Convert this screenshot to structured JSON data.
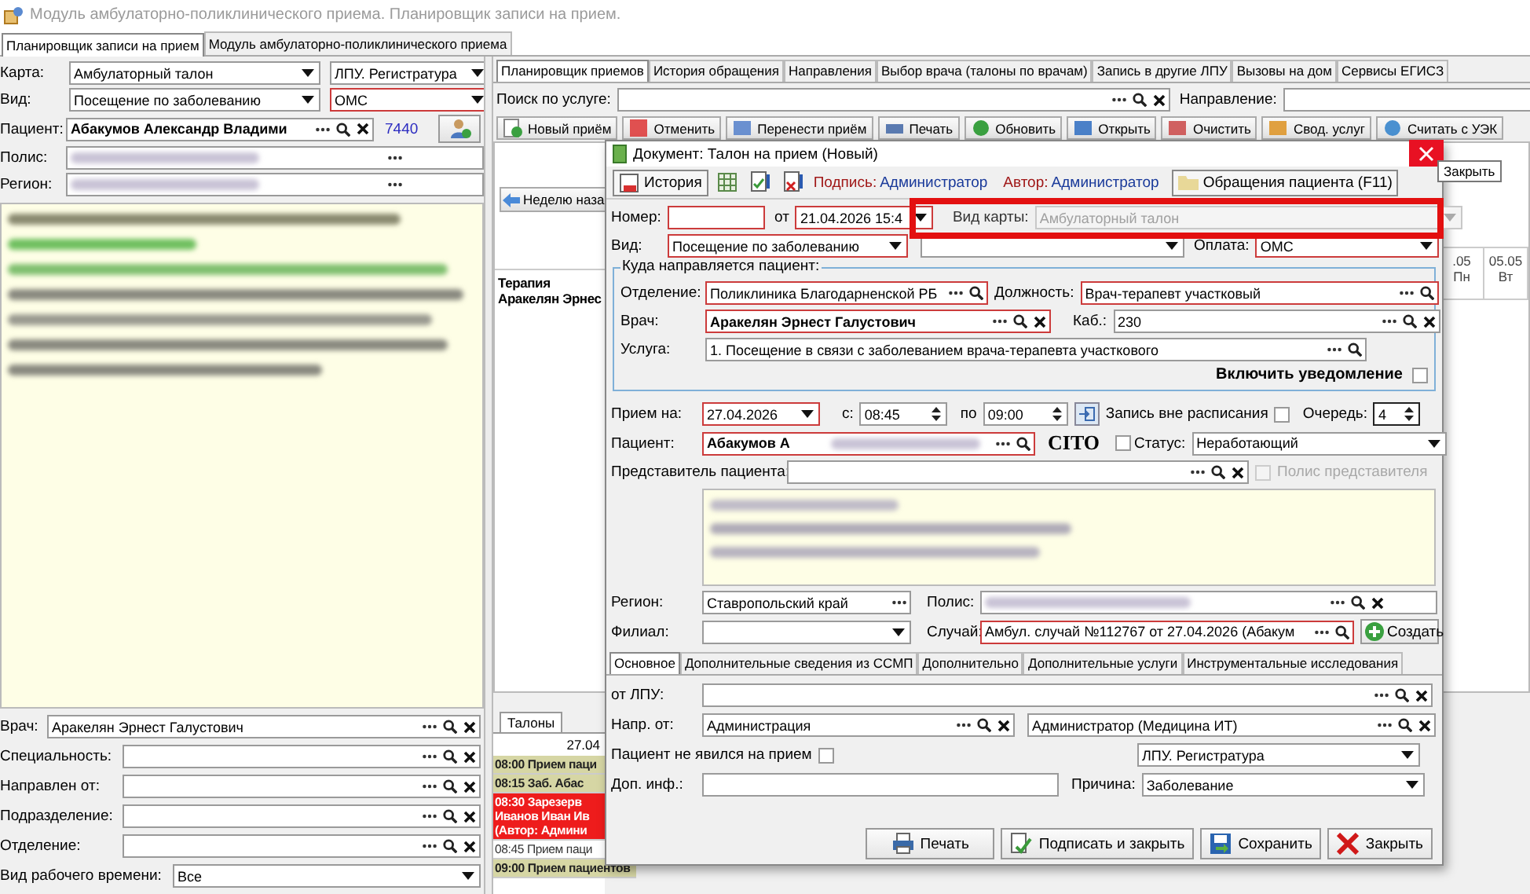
{
  "window": {
    "title": "Модуль амбулаторно-поликлинического приема. Планировщик записи на прием."
  },
  "module_tabs": [
    {
      "label": "Планировщик записи на прием",
      "selected": true
    },
    {
      "label": "Модуль амбулаторно-поликлинического приема",
      "selected": false
    }
  ],
  "left_panel": {
    "rows": [
      {
        "label": "Карта:",
        "fields": [
          {
            "kind": "combo",
            "value": "Амбулаторный талон",
            "invalid": false
          },
          {
            "kind": "combo",
            "value": "ЛПУ. Регистратура",
            "invalid": false
          }
        ]
      },
      {
        "label": "Вид:",
        "fields": [
          {
            "kind": "combo",
            "value": "Посещение по заболеванию",
            "invalid": false
          },
          {
            "kind": "combo",
            "value": "ОМС",
            "invalid": true
          }
        ]
      },
      {
        "label": "Пациент:",
        "fields": [
          {
            "kind": "lookup",
            "value": "Абакумов Александр Владими",
            "invalid": false,
            "searchable": true,
            "clearable": true
          }
        ],
        "link": "7440"
      },
      {
        "label": "Полис:",
        "fields": [
          {
            "kind": "lookup",
            "invalid": false,
            "redacted": true,
            "searchable": false,
            "clearable": false
          }
        ]
      },
      {
        "label": "Регион:",
        "fields": [
          {
            "kind": "lookup",
            "invalid": false,
            "redacted": true,
            "searchable": false,
            "clearable": false
          }
        ]
      }
    ],
    "lower_rows": [
      {
        "label": "Врач:",
        "field": {
          "kind": "lookup",
          "value": "Аракелян Эрнест Галустович",
          "invalid": false,
          "searchable": true,
          "clearable": true
        }
      },
      {
        "label": "Специальность:",
        "field": {
          "kind": "lookup",
          "invalid": false,
          "searchable": true,
          "clearable": true
        }
      },
      {
        "label": "Направлен от:",
        "field": {
          "kind": "lookup",
          "invalid": false,
          "searchable": true,
          "clearable": true
        }
      },
      {
        "label": "Подразделение:",
        "field": {
          "kind": "lookup",
          "invalid": false,
          "searchable": true,
          "clearable": true
        }
      },
      {
        "label": "Отделение:",
        "field": {
          "kind": "lookup",
          "invalid": false,
          "searchable": true,
          "clearable": true
        }
      },
      {
        "label": "Вид рабочего времени:",
        "field": {
          "kind": "combo",
          "value": "Все",
          "invalid": false
        }
      }
    ]
  },
  "right_panel": {
    "tabs": [
      {
        "label": "Планировщик приемов",
        "selected": true
      },
      {
        "label": "История обращения",
        "selected": false
      },
      {
        "label": "Направления",
        "selected": false
      },
      {
        "label": "Выбор врача (талоны по врачам)",
        "selected": false
      },
      {
        "label": "Запись в другие ЛПУ",
        "selected": false
      },
      {
        "label": "Вызовы на дом",
        "selected": false
      },
      {
        "label": "Сервисы ЕГИСЗ",
        "selected": false
      }
    ],
    "search_label": "Поиск по услуге:",
    "direction_label": "Направление:",
    "toolbar": [
      {
        "label": "Новый приём",
        "kind": "new"
      },
      {
        "label": "Отменить",
        "kind": "cancel"
      },
      {
        "label": "Перенести приём",
        "kind": "move"
      },
      {
        "label": "Печать",
        "kind": "print"
      },
      {
        "label": "Обновить",
        "kind": "refresh"
      },
      {
        "label": "Открыть",
        "kind": "open"
      },
      {
        "label": "Очистить",
        "kind": "clear"
      },
      {
        "label": "Свод. услуг",
        "kind": "summary"
      },
      {
        "label": "Считать с УЭК",
        "kind": "card"
      }
    ],
    "week_back": "Неделю наза",
    "days": [
      {
        "date": ".05",
        "weekday": "Пн"
      },
      {
        "date": "05.05",
        "weekday": "Вт"
      }
    ],
    "schedule_column": [
      "Терапия",
      "Аракелян Эрнес"
    ],
    "talons_tab": "Талоны",
    "talons_date": "27.04",
    "talons": [
      {
        "lines": [
          "08:00 Прием паци"
        ],
        "kind": "open"
      },
      {
        "lines": [
          "08:15 Заб. Абас"
        ],
        "kind": "booked"
      },
      {
        "lines": [
          "08:30 Зарезерв",
          "Иванов Иван Ив",
          "(Автор: Админи"
        ],
        "kind": "reserved"
      },
      {
        "lines": [
          "08:45 Прием паци"
        ],
        "kind": "plain"
      },
      {
        "lines": [
          "09:00 Прием пациентов"
        ],
        "kind": "open"
      }
    ]
  },
  "dialog": {
    "title": "Документ: Талон на прием (Новый)",
    "close_tooltip": "Закрыть",
    "history": "История",
    "signature_label": "Подпись:",
    "signature": "Администратор",
    "author_label": "Автор:",
    "author": "Администратор",
    "visits": "Обращения пациента (F11)",
    "number": {
      "label": "Номер:",
      "kind": "text",
      "invalid": true
    },
    "date": {
      "label": "от",
      "kind": "combo",
      "value": "21.04.2026 15:4",
      "invalid": true
    },
    "card_type": {
      "label": "Вид карты:",
      "kind": "combo",
      "value": "Амбулаторный талон",
      "invalid": false,
      "disabled": true,
      "highlighted": true
    },
    "visit_type": {
      "label": "Вид:",
      "kind": "combo",
      "value": "Посещение по заболеванию",
      "invalid": true
    },
    "visit_subtype": {
      "kind": "combo",
      "invalid": false
    },
    "payment": {
      "label": "Оплата:",
      "kind": "combo",
      "value": "ОМС",
      "invalid": true
    },
    "destination_title": "Куда направляется пациент:",
    "department": {
      "label": "Отделение:",
      "kind": "lookup",
      "value": "Поликлиника Благодарненской РБ",
      "invalid": true,
      "searchable": true,
      "clearable": false
    },
    "position": {
      "label": "Должность:",
      "kind": "lookup",
      "value": "Врач-терапевт участковый",
      "invalid": true,
      "searchable": true,
      "clearable": false
    },
    "doctor": {
      "label": "Врач:",
      "kind": "lookup",
      "value": "Аракелян Эрнест Галустович",
      "invalid": true,
      "searchable": true,
      "clearable": true
    },
    "room": {
      "label": "Каб.:",
      "kind": "lookup",
      "value": "230",
      "invalid": false,
      "searchable": true,
      "clearable": true
    },
    "service": {
      "label": "Услуга:",
      "kind": "lookup",
      "value": "1. Посещение в связи с заболеванием врача-терапевта участкового",
      "invalid": false,
      "searchable": true,
      "clearable": false
    },
    "notify": {
      "label": "Включить уведомление",
      "checked": false
    },
    "appt_date": {
      "label": "Прием на:",
      "kind": "combo",
      "value": "27.04.2026",
      "invalid": true
    },
    "time_from": {
      "label": "с:",
      "kind": "spin",
      "value": "08:45",
      "invalid": false
    },
    "time_to": {
      "label": "по",
      "kind": "spin",
      "value": "09:00",
      "invalid": false
    },
    "off_schedule": {
      "label": "Запись вне расписания",
      "checked": false
    },
    "queue": {
      "label": "Очередь:",
      "kind": "spin",
      "value": "4",
      "invalid": false
    },
    "patient": {
      "label": "Пациент:",
      "kind": "lookup",
      "value": "Абакумов А",
      "invalid": true,
      "redacted": true,
      "searchable": true,
      "clearable": false
    },
    "cito": "CITO",
    "status_check": {
      "checked": false
    },
    "status": {
      "label": "Статус:",
      "kind": "combo",
      "value": "Неработающий",
      "invalid": false
    },
    "representative": {
      "label": "Представитель пациента:",
      "kind": "lookup",
      "invalid": false,
      "searchable": true,
      "clearable": true
    },
    "rep_policy": {
      "label": "Полис представителя",
      "checked": false,
      "disabled": true
    },
    "region": {
      "label": "Регион:",
      "kind": "lookup",
      "value": "Ставропольский край",
      "invalid": false,
      "searchable": false,
      "clearable": false
    },
    "policy": {
      "label": "Полис:",
      "kind": "lookup",
      "invalid": false,
      "redacted": true,
      "searchable": true,
      "clearable": true
    },
    "branch": {
      "label": "Филиал:",
      "kind": "combo",
      "invalid": false
    },
    "case": {
      "label": "Случай:",
      "kind": "lookup",
      "value": "Амбул. случай №112767 от 27.04.2026 (Абакум",
      "invalid": true,
      "searchable": true,
      "clearable": false
    },
    "create": "Создать",
    "tabs": [
      {
        "label": "Основное",
        "selected": true
      },
      {
        "label": "Дополнительные сведения из ССМП",
        "selected": false
      },
      {
        "label": "Дополнительно",
        "selected": false
      },
      {
        "label": "Дополнительные услуги",
        "selected": false
      },
      {
        "label": "Инструментальные исследования",
        "selected": false
      }
    ],
    "from_lpu": {
      "label": "от ЛПУ:",
      "kind": "lookup",
      "invalid": false,
      "searchable": true,
      "clearable": true
    },
    "ref_from": {
      "label": "Напр. от:",
      "kind": "lookup",
      "value": "Администрация",
      "invalid": false,
      "searchable": true,
      "clearable": true
    },
    "ref_person": {
      "kind": "lookup",
      "value": "Администратор (Медицина ИТ)",
      "invalid": false,
      "searchable": true,
      "clearable": true
    },
    "no_show": {
      "label": "Пациент не явился на прием",
      "checked": false
    },
    "lpu": {
      "kind": "combo",
      "value": "ЛПУ. Регистратура",
      "invalid": false
    },
    "extra_info": {
      "label": "Доп. инф.:",
      "kind": "text",
      "invalid": false
    },
    "reason": {
      "label": "Причина:",
      "kind": "combo",
      "value": "Заболевание",
      "invalid": false
    },
    "buttons": [
      {
        "label": "Печать",
        "kind": "print"
      },
      {
        "label": "Подписать и закрыть",
        "kind": "sign"
      },
      {
        "label": "Сохранить",
        "kind": "save"
      },
      {
        "label": "Закрыть",
        "kind": "close"
      }
    ]
  }
}
